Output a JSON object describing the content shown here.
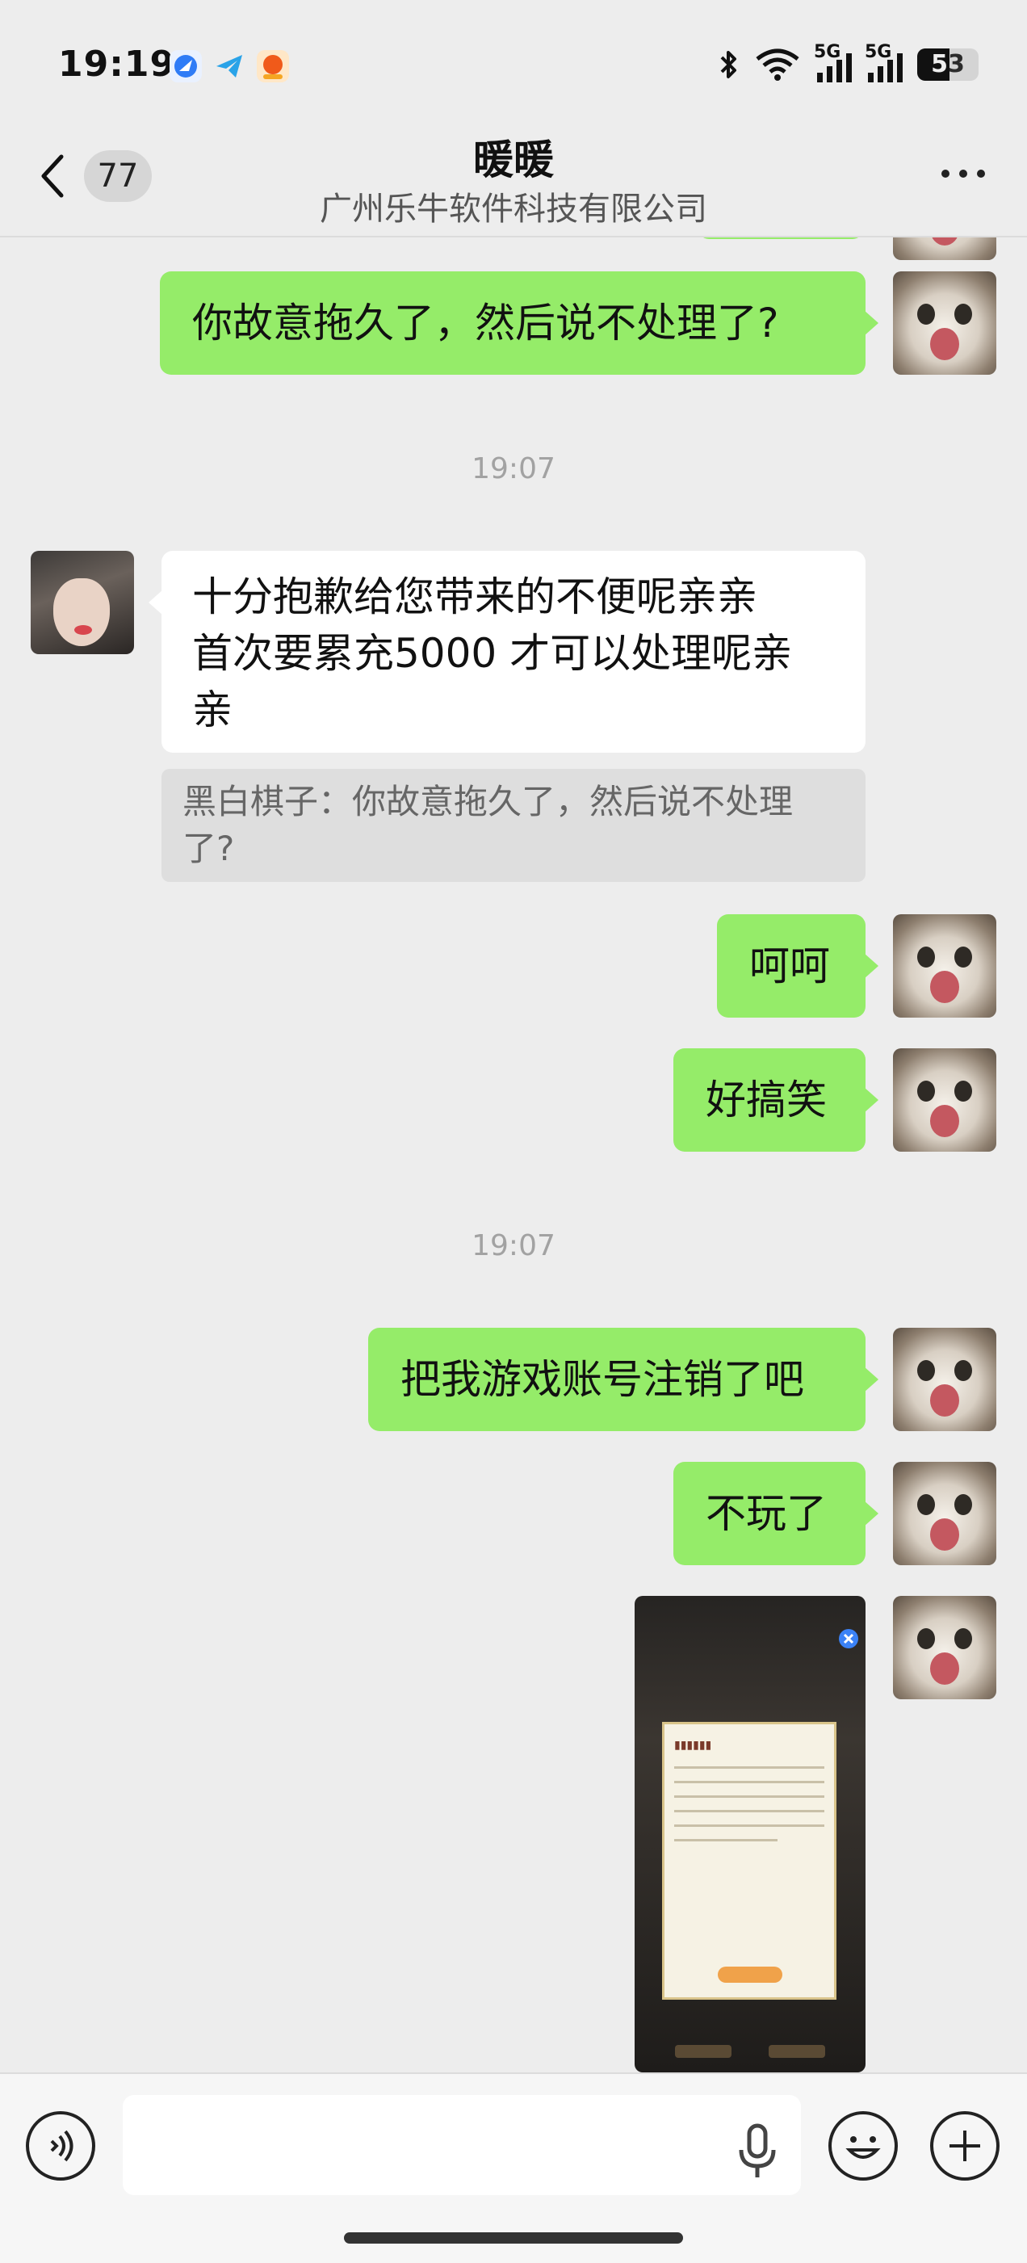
{
  "status_bar": {
    "time": "19:19",
    "network_1": "5G",
    "network_2": "5G",
    "battery_level": "53",
    "app_icons": [
      "browser-icon",
      "telegram-icon",
      "app-icon"
    ]
  },
  "header": {
    "back_count": "77",
    "title": "暖暖",
    "subtitle": "广州乐牛软件科技有限公司"
  },
  "messages": [
    {
      "sender": "me",
      "type": "text",
      "text": "你故意拖久了，然后说不处理了?"
    },
    {
      "type": "time",
      "text": "19:07"
    },
    {
      "sender": "them",
      "type": "text",
      "lines": [
        "十分抱歉给您带来的不便呢亲亲",
        "首次要累充5000  才可以处理呢亲",
        "亲"
      ],
      "quote_lines": [
        "黑白棋子：你故意拖久了，然后说不处理",
        "了?"
      ]
    },
    {
      "sender": "me",
      "type": "text",
      "text": "呵呵"
    },
    {
      "sender": "me",
      "type": "text",
      "text": "好搞笑"
    },
    {
      "type": "time",
      "text": "19:07"
    },
    {
      "sender": "me",
      "type": "text",
      "text": "把我游戏账号注销了吧"
    },
    {
      "sender": "me",
      "type": "text",
      "text": "不玩了"
    },
    {
      "sender": "me",
      "type": "image",
      "image": "game-screenshot"
    }
  ],
  "colors": {
    "my_bubble": "#95ec69",
    "their_bubble": "#ffffff",
    "background": "#ededed"
  }
}
